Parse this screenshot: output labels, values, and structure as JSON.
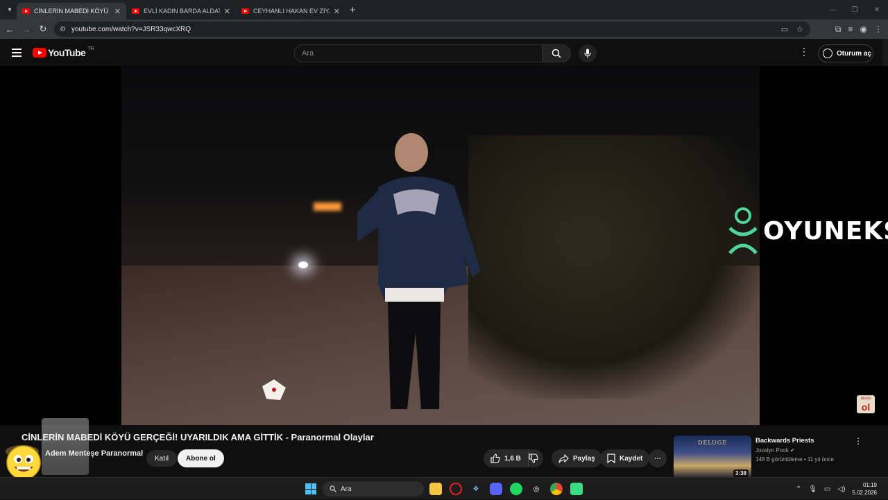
{
  "browser": {
    "tabs": [
      {
        "title": "CİNLERİN MABEDİ KÖYÜ GERÇEĞİ",
        "active": true
      },
      {
        "title": "EVLİ KADIN BARDA ALDATTI | -",
        "active": false
      },
      {
        "title": "CEYHANLI HAKAN EV ZİYARETİ",
        "active": false
      }
    ],
    "url": "youtube.com/watch?v=JSR33qwcXRQ"
  },
  "youtube": {
    "logo_text": "YouTube",
    "region": "TR",
    "search_placeholder": "Ara",
    "signin_label": "Oturum aç"
  },
  "video": {
    "watermark": "OYUNEKS",
    "badge_top": "Abone",
    "badge_bottom": "ol",
    "title": "CİNLERİN MABEDİ KÖYÜ GERÇEĞİ! UYARILDIK AMA GİTTİK - Paranormal Olaylar",
    "channel": "Adem Menteşe Paranormal",
    "join_label": "Katıl",
    "subscribe_label": "Abone ol",
    "likes": "1,6 B",
    "share_label": "Paylaş",
    "save_label": "Kaydet"
  },
  "recommendation": {
    "thumb_text": "DELUGE",
    "duration": "3:38",
    "title": "Backwards Priests",
    "channel": "Jocelyn Pook",
    "meta": "148 B görüntüleme • 11 yıl önce"
  },
  "taskbar": {
    "search_label": "Ara",
    "time": "01:19",
    "date": "5.02.2026"
  }
}
